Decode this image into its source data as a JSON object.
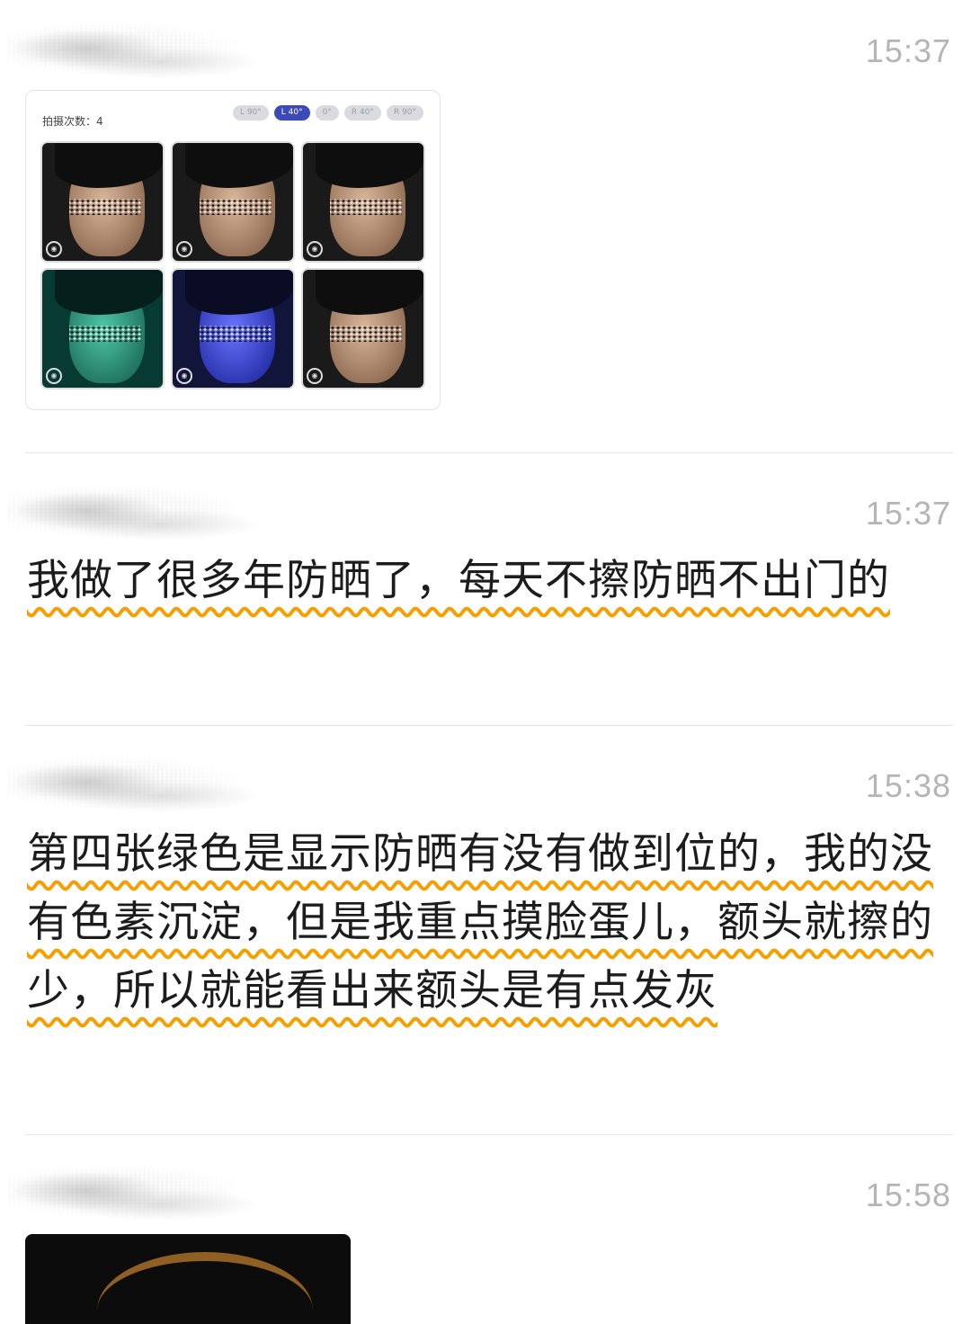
{
  "messages": [
    {
      "time": "15:37",
      "image": {
        "shot_count_label": "拍摄次数：4",
        "angles": [
          "L 90°",
          "L 40°",
          "0°",
          "R 40°",
          "R 90°"
        ],
        "active_angle": "L 40°"
      }
    },
    {
      "time": "15:37",
      "text": "我做了很多年防晒了，每天不擦防晒不出门的"
    },
    {
      "time": "15:38",
      "text": "第四张绿色是显示防晒有没有做到位的，我的没有色素沉淀，但是我重点摸脸蛋儿，额头就擦的少，所以就能看出来额头是有点发灰"
    },
    {
      "time": "15:58"
    }
  ],
  "colors": {
    "timestamp": "#b5b5b5",
    "underline": "#f5a000",
    "active_pill": "#3c4ab8"
  },
  "icons": [
    "camera-icon"
  ]
}
